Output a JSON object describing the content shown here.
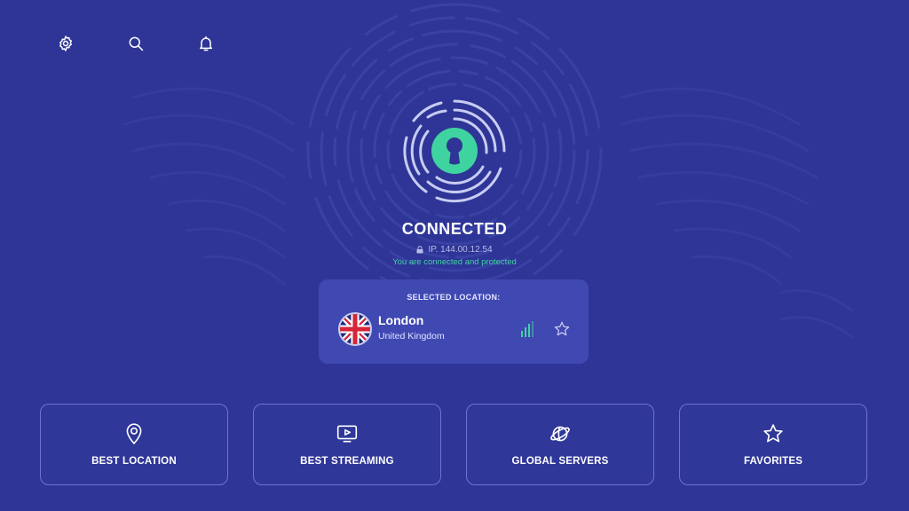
{
  "header": {
    "icons": [
      "gear-icon",
      "search-icon",
      "bell-icon"
    ]
  },
  "status": {
    "title": "CONNECTED",
    "ip_label": "IP. 144.00.12.54",
    "message": "You are connected and protected"
  },
  "selected_location": {
    "heading": "SELECTED LOCATION:",
    "city": "London",
    "country": "United Kingdom",
    "flag_icon": "uk-flag-icon",
    "signal_icon": "signal-bars-icon",
    "favorite_icon": "star-outline-icon"
  },
  "tiles": [
    {
      "label": "BEST LOCATION",
      "icon": "location-pin-icon"
    },
    {
      "label": "BEST STREAMING",
      "icon": "tv-play-icon"
    },
    {
      "label": "GLOBAL SERVERS",
      "icon": "globe-ring-icon"
    },
    {
      "label": "FAVORITES",
      "icon": "star-outline-icon"
    }
  ],
  "colors": {
    "background": "#2e3596",
    "card": "#4048b2",
    "accent_green": "#3fd3a0",
    "tile_border": "#6d74cd"
  }
}
